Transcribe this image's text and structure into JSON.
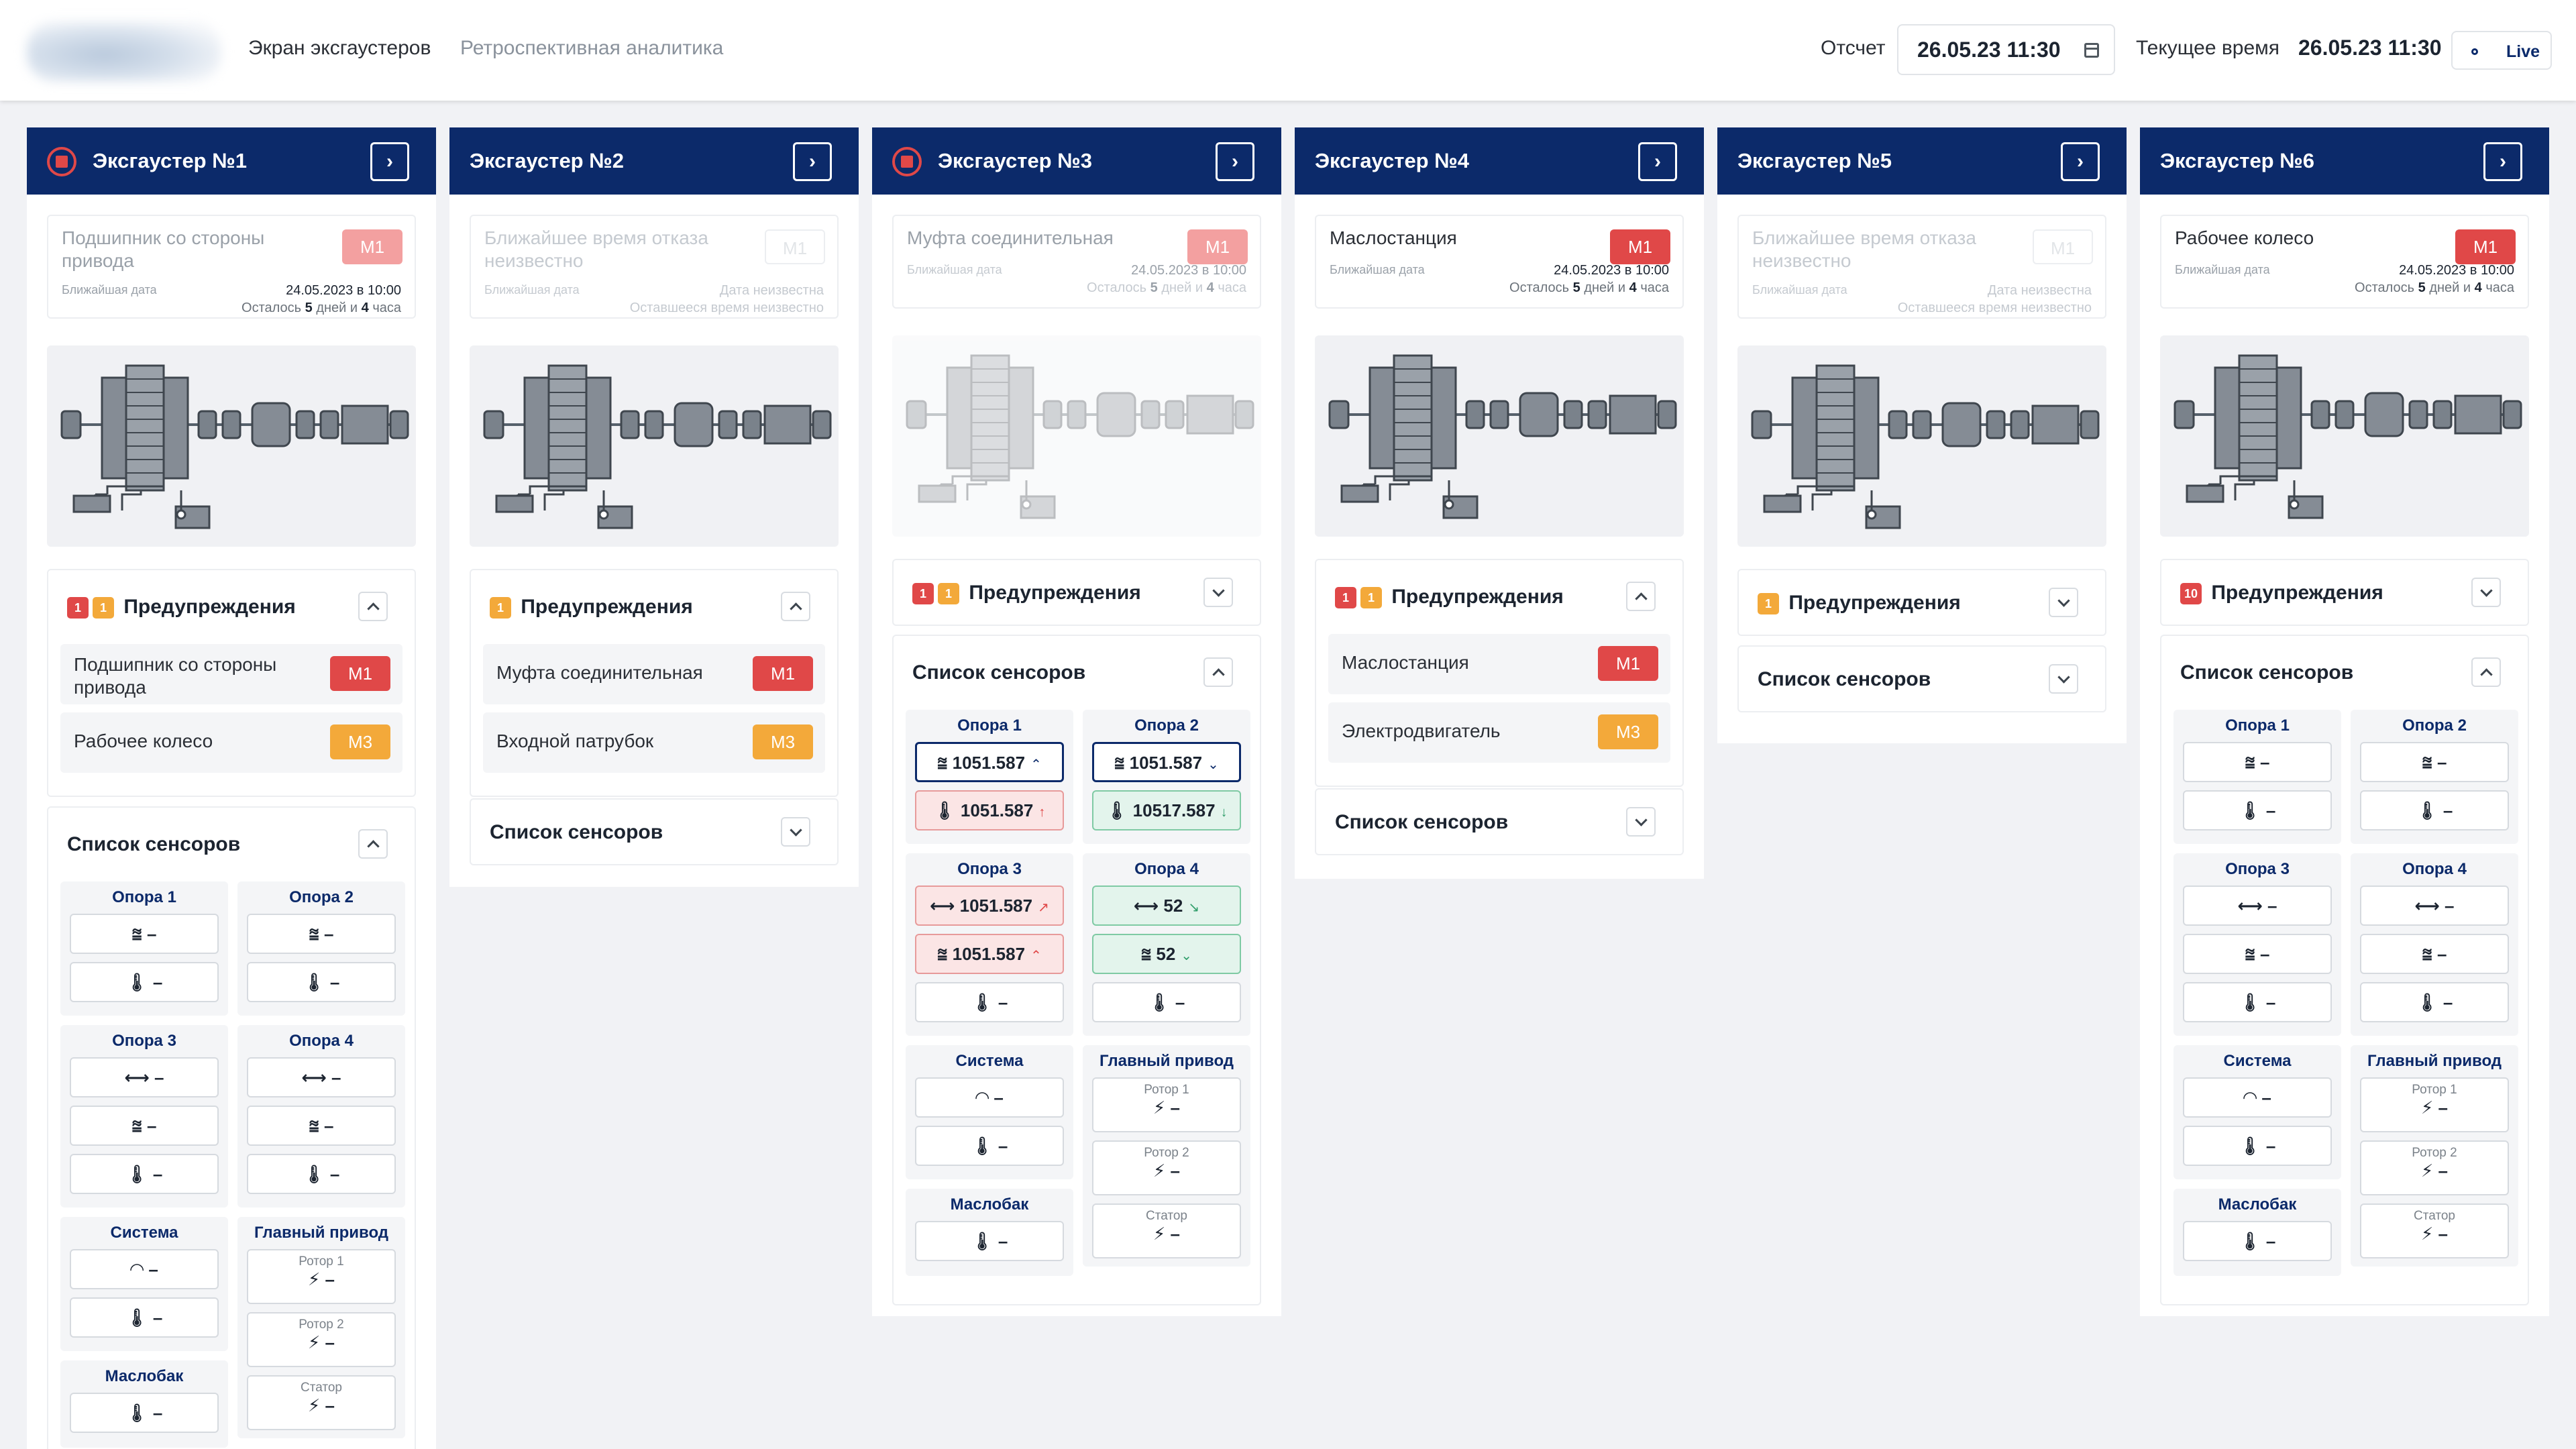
{
  "header": {
    "nav_exhausters": "Экран эксгаустеров",
    "nav_retro": "Ретроспективная аналитика",
    "report_label": "Отсчет",
    "report_value": "26.05.23 11:30",
    "current_label": "Текущее время",
    "current_value": "26.05.23 11:30",
    "live_label": "Live"
  },
  "labels": {
    "warnings": "Предупреждения",
    "sensors": "Список сенсоров",
    "nearest_date": "Ближайшая дата",
    "remaining_prefix": "Осталось",
    "days": "дней и",
    "hours": "часа",
    "unknown_title": "Ближайшее время отказа неизвестно",
    "unknown_date": "Дата неизвестна",
    "unknown_remaining": "Оставшееся время неизвестно",
    "opora1": "Опора 1",
    "opora2": "Опора 2",
    "opora3": "Опора 3",
    "opora4": "Опора 4",
    "system": "Система",
    "main_drive": "Главный привод",
    "oil_tank": "Маслобак",
    "rotor1": "Ротор 1",
    "rotor2": "Ротор 2",
    "stator": "Статор",
    "dash": "–"
  },
  "exhausters": [
    {
      "title": "Эксгаустер №1",
      "stopped": true,
      "pred_name": "Подшипник со стороны привода",
      "pred_mark": "M1",
      "pred_date": "24.05.2023 в 10:00",
      "pred_days": "5",
      "pred_hours": "4",
      "warn_counts": [
        "1",
        "1"
      ],
      "warnings": [
        {
          "text": "Подшипник со стороны привода",
          "mark": "M1"
        },
        {
          "text": "Рабочее колесо",
          "mark": "M3"
        }
      ]
    },
    {
      "title": "Эксгаустер №2",
      "stopped": false,
      "pred_mark": "M1",
      "warn_counts": [
        "1"
      ],
      "warnings": [
        {
          "text": "Муфта соединительная",
          "mark": "M1"
        },
        {
          "text": "Входной патрубок",
          "mark": "M3"
        }
      ]
    },
    {
      "title": "Эксгаустер №3",
      "stopped": true,
      "pred_name": "Муфта соединительная",
      "pred_mark": "M1",
      "pred_date": "24.05.2023 в 10:00",
      "pred_days": "5",
      "pred_hours": "4",
      "warn_counts": [
        "1",
        "1"
      ],
      "sensors": {
        "o1a": "1051.587",
        "o1b": "1051.587",
        "o2a": "1051.587",
        "o2b": "10517.587",
        "o3a": "1051.587",
        "o3b": "1051.587",
        "o4a": "52",
        "o4b": "52"
      }
    },
    {
      "title": "Эксгаустер №4",
      "stopped": false,
      "pred_name": "Маслостанция",
      "pred_mark": "M1",
      "pred_date": "24.05.2023 в 10:00",
      "pred_days": "5",
      "pred_hours": "4",
      "warn_counts": [
        "1",
        "1"
      ],
      "warnings": [
        {
          "text": "Маслостанция",
          "mark": "M1"
        },
        {
          "text": "Электродвигатель",
          "mark": "M3"
        }
      ]
    },
    {
      "title": "Эксгаустер №5",
      "stopped": false,
      "pred_mark": "M1",
      "warn_counts": [
        "1"
      ]
    },
    {
      "title": "Эксгаустер №6",
      "stopped": false,
      "pred_name": "Рабочее колесо",
      "pred_mark": "M1",
      "pred_date": "24.05.2023 в 10:00",
      "pred_days": "5",
      "pred_hours": "4",
      "warn_counts": [
        "10"
      ]
    }
  ],
  "colors": {
    "navy": "#0c2a6a",
    "red": "#e04848",
    "yellow": "#f3a93a",
    "green": "#2f9d6a"
  }
}
